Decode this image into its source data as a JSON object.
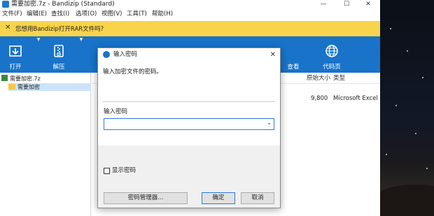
{
  "window": {
    "title": "需要加密.7z - Bandizip (Standard)",
    "controls": {
      "minimize": "—",
      "maximize": "☐",
      "close": "✕"
    }
  },
  "menu": [
    "文件(F)",
    "编辑(E)",
    "查找(I)",
    "选项(O)",
    "视图(V)",
    "工具(T)",
    "帮助(H)"
  ],
  "notice": {
    "close": "✕",
    "text": "您想用Bandizip打开RAR文件吗?"
  },
  "toolbar": {
    "open_label": "打开",
    "extract_label": "解压",
    "view_label": "查看",
    "codepage_label": "代码页",
    "open_drop": "▾",
    "extract_drop": "▾"
  },
  "sidebar": {
    "archive": "需要加密.7z",
    "folder": "需要加密"
  },
  "list": {
    "columns": {
      "size": "原始大小",
      "type": "类型"
    },
    "rows": [
      {
        "size": "9,800",
        "type": "Microsoft Excel 工"
      }
    ]
  },
  "dialog": {
    "title": "输入密码",
    "close": "✕",
    "description": "输入加密文件的密码。",
    "field_label": "输入密码",
    "password_value": "",
    "chevron": "⌄",
    "show_password_label": "显示密码",
    "password_manager_button": "密码管理器...",
    "ok_button": "确定",
    "cancel_button": "取消"
  }
}
